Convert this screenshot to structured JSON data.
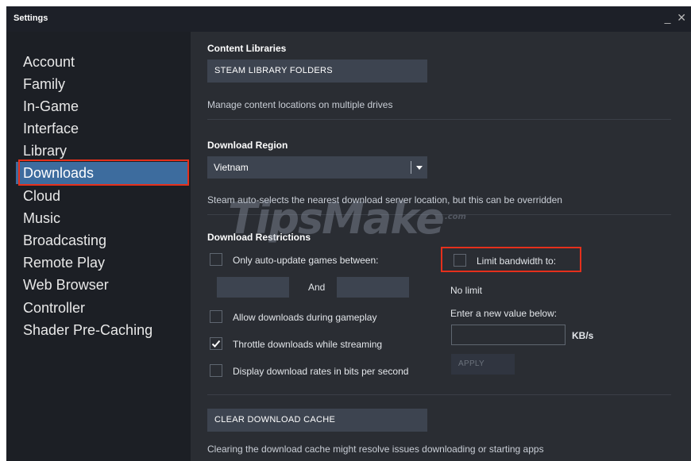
{
  "window": {
    "title": "Settings",
    "minimize": "_",
    "close": "✕"
  },
  "sidebar": {
    "items": [
      {
        "label": "Account"
      },
      {
        "label": "Family"
      },
      {
        "label": "In-Game"
      },
      {
        "label": "Interface"
      },
      {
        "label": "Library"
      },
      {
        "label": "Downloads",
        "active": true
      },
      {
        "label": "Cloud"
      },
      {
        "label": "Music"
      },
      {
        "label": "Broadcasting"
      },
      {
        "label": "Remote Play"
      },
      {
        "label": "Web Browser"
      },
      {
        "label": "Controller"
      },
      {
        "label": "Shader Pre-Caching"
      }
    ]
  },
  "content_libraries": {
    "title": "Content Libraries",
    "button": "STEAM LIBRARY FOLDERS",
    "desc": "Manage content locations on multiple drives"
  },
  "download_region": {
    "title": "Download Region",
    "selected": "Vietnam",
    "desc": "Steam auto-selects the nearest download server location, but this can be overridden"
  },
  "restrictions": {
    "title": "Download Restrictions",
    "auto_update_label": "Only auto-update games between:",
    "and_label": "And",
    "allow_gameplay_label": "Allow downloads during gameplay",
    "throttle_label": "Throttle downloads while streaming",
    "bits_label": "Display download rates in bits per second",
    "limit_bandwidth_label": "Limit bandwidth to:",
    "no_limit": "No limit",
    "enter_value": "Enter a new value below:",
    "unit": "KB/s",
    "apply": "APPLY"
  },
  "cache": {
    "button": "CLEAR DOWNLOAD CACHE",
    "desc": "Clearing the download cache might resolve issues downloading or starting apps"
  },
  "watermark": {
    "text": "TipsMake",
    "suffix": ".com"
  },
  "colors": {
    "highlight": "#e5301c",
    "active_nav": "#3d6c9e",
    "background": "#2a2d33"
  }
}
